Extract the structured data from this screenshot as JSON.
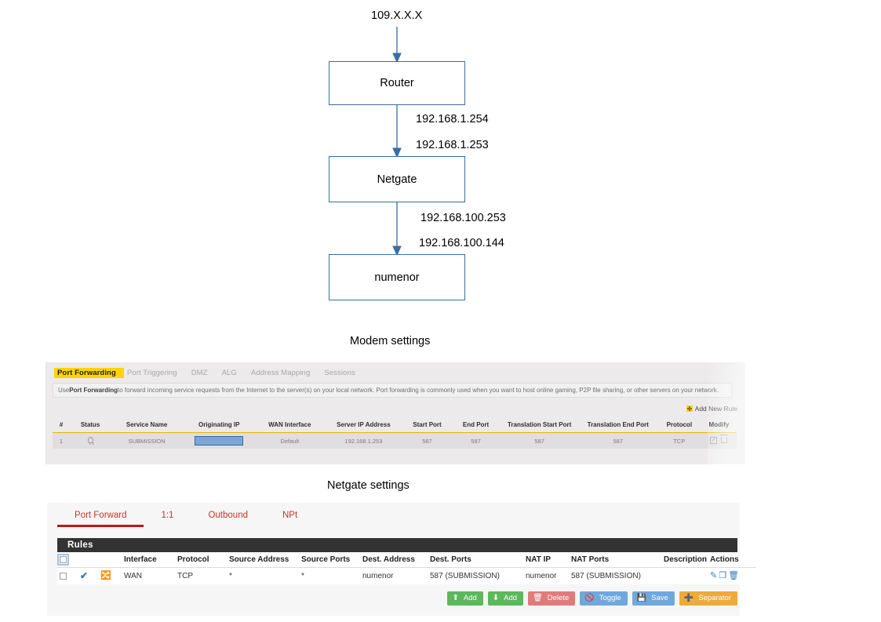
{
  "diagram": {
    "wan_ip": "109.X.X.X",
    "nodes": [
      {
        "name": "Router"
      },
      {
        "name": "Netgate"
      },
      {
        "name": "numenor"
      }
    ],
    "edge_labels": {
      "router_down": "192.168.1.254",
      "netgate_up": "192.168.1.253",
      "netgate_down": "192.168.100.253",
      "numenor_up": "192.168.100.144"
    }
  },
  "captions": {
    "modem": "Modem settings",
    "netgate": "Netgate settings"
  },
  "modem": {
    "tabs": [
      {
        "label": "Port Forwarding",
        "active": true
      },
      {
        "label": "Port Triggering",
        "active": false
      },
      {
        "label": "DMZ",
        "active": false
      },
      {
        "label": "ALG",
        "active": false
      },
      {
        "label": "Address Mapping",
        "active": false
      },
      {
        "label": "Sessions",
        "active": false
      }
    ],
    "description_prefix": "Use ",
    "description_bold": "Port Forwarding",
    "description_suffix": " to forward incoming service requests from the Internet to the server(s) on your local network. Port forwarding is commonly used when you want to host online gaming, P2P file sharing, or other servers on your network.",
    "add_new_rule_label": "Add New Rule",
    "columns": [
      "#",
      "Status",
      "Service Name",
      "Originating IP",
      "WAN Interface",
      "Server IP Address",
      "Start Port",
      "End Port",
      "Translation Start Port",
      "Translation End Port",
      "Protocol",
      "Modify"
    ],
    "row": {
      "index": "1",
      "status_icon": "lightbulb-icon",
      "service_name": "SUBMISSION",
      "originating_ip": "",
      "wan_interface": "Default",
      "server_ip_address": "192.168.1.253",
      "start_port": "587",
      "end_port": "587",
      "translation_start_port": "587",
      "translation_end_port": "587",
      "protocol": "TCP"
    },
    "colors": {
      "active_tab_highlight": "#ffd400",
      "header_rule": "#e8b800",
      "selection_blue": "#7ba7d7"
    }
  },
  "pfsense": {
    "tabs": [
      {
        "label": "Port Forward",
        "active": true
      },
      {
        "label": "1:1",
        "active": false
      },
      {
        "label": "Outbound",
        "active": false
      },
      {
        "label": "NPt",
        "active": false
      }
    ],
    "rules_title": "Rules",
    "columns": [
      "Interface",
      "Protocol",
      "Source Address",
      "Source Ports",
      "Dest. Address",
      "Dest. Ports",
      "NAT IP",
      "NAT Ports",
      "Description",
      "Actions"
    ],
    "row": {
      "interface": "WAN",
      "protocol": "TCP",
      "source_address": "*",
      "source_ports": "*",
      "dest_address": "numenor",
      "dest_ports": "587 (SUBMISSION)",
      "nat_ip": "numenor",
      "nat_ports": "587 (SUBMISSION)",
      "description": ""
    },
    "buttons": [
      {
        "label": "Add",
        "icon": "arrow-up-icon",
        "style": "green"
      },
      {
        "label": "Add",
        "icon": "arrow-down-icon",
        "style": "green"
      },
      {
        "label": "Delete",
        "icon": "trash-icon",
        "style": "red"
      },
      {
        "label": "Toggle",
        "icon": "ban-icon",
        "style": "blue"
      },
      {
        "label": "Save",
        "icon": "floppy-icon",
        "style": "blue"
      },
      {
        "label": "Separator",
        "icon": "plus-icon",
        "style": "orange"
      }
    ],
    "colors": {
      "tab_text": "#c0392b",
      "tab_underline": "#b8191a",
      "rules_header_bg": "#333333",
      "link": "#337ab7"
    }
  }
}
